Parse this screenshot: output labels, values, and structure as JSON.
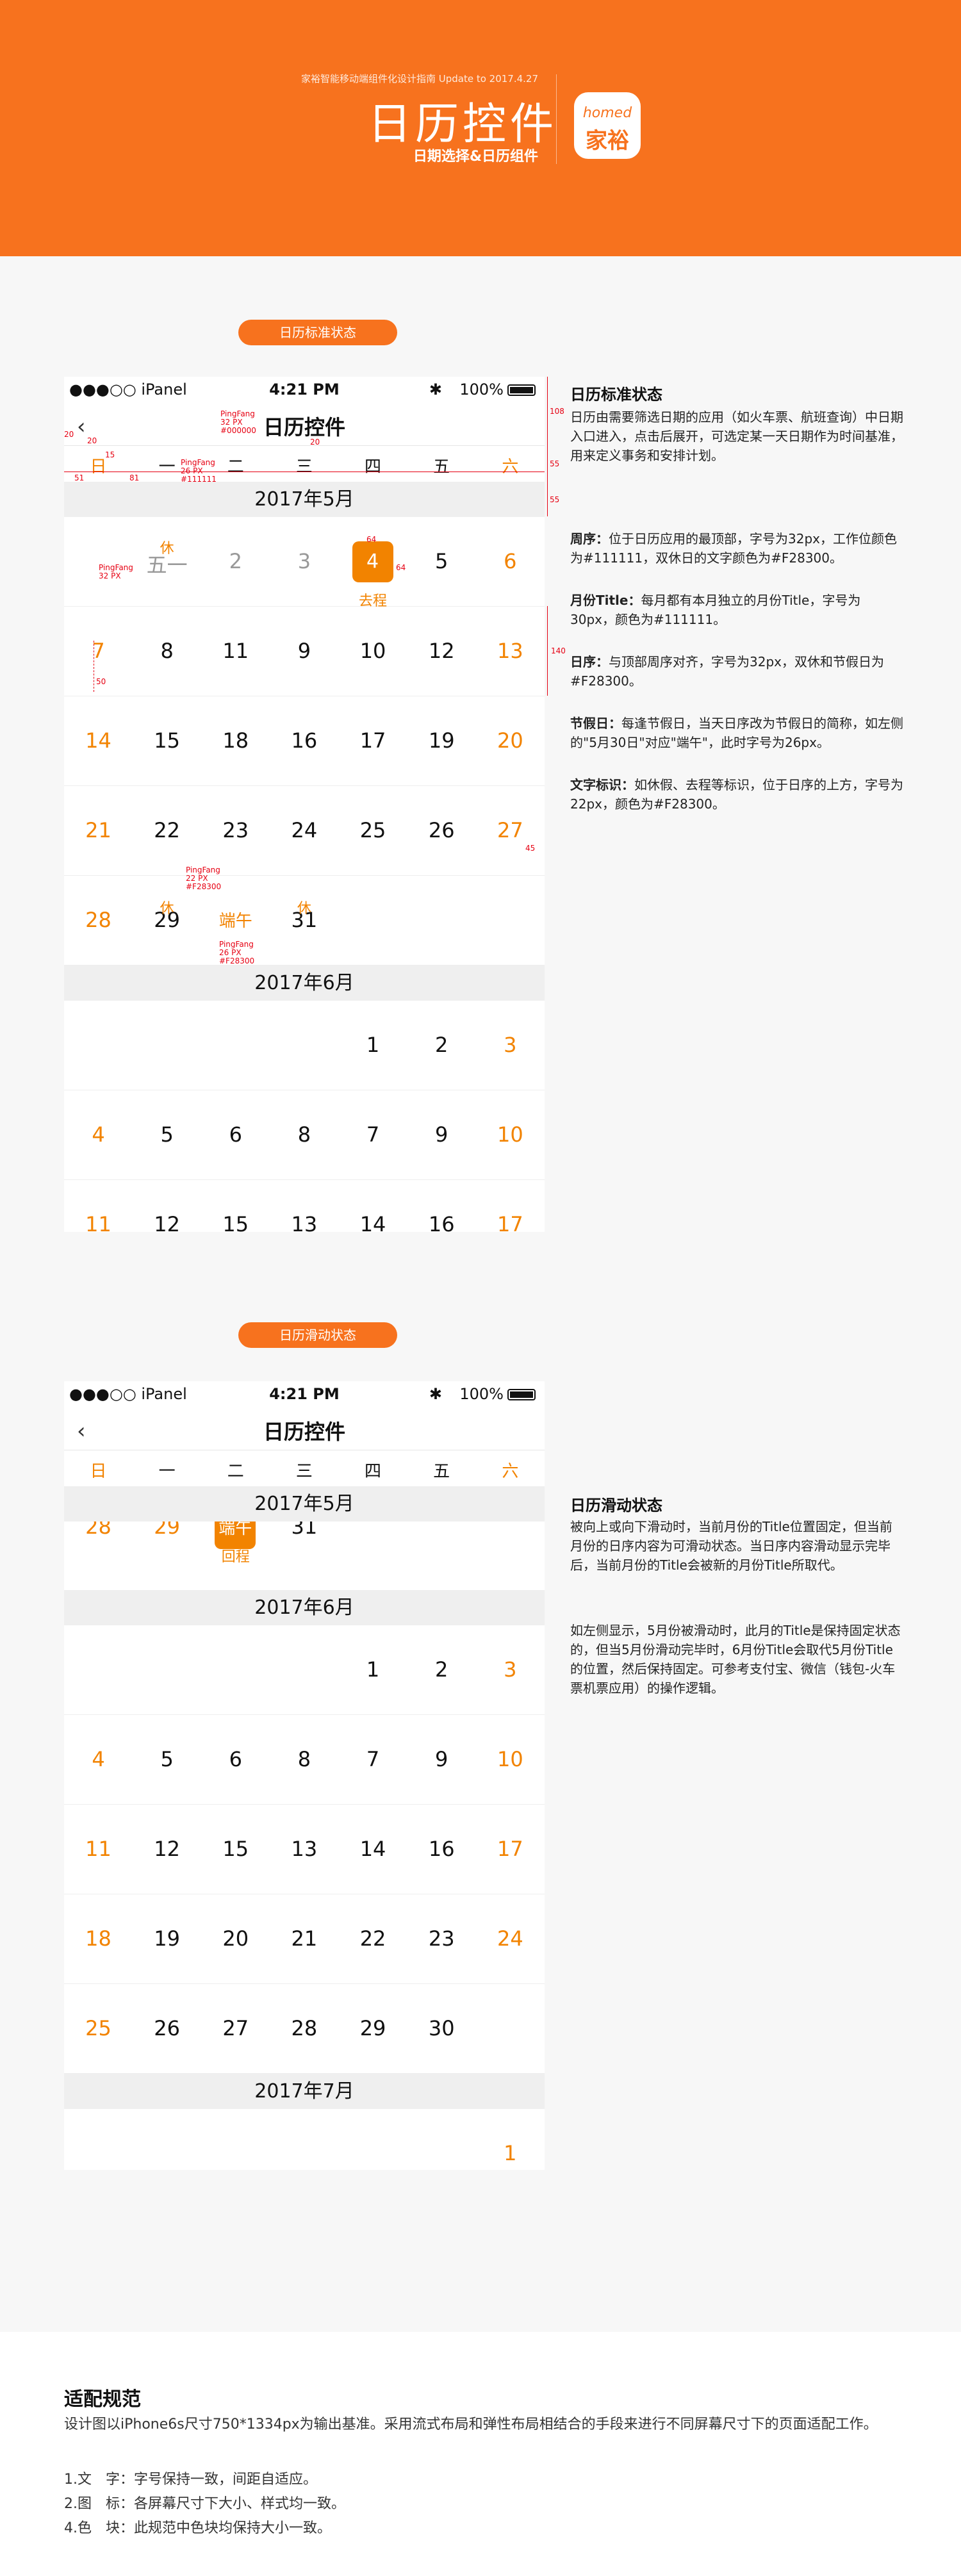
{
  "header": {
    "subtitle": "家裕智能移动端组件化设计指南  Update to 2017.4.27",
    "title": "日历控件",
    "desc": "日期选择&日历组件",
    "logo_top": "homed",
    "logo_bottom": "家裕"
  },
  "section1": {
    "pill": "日历标准状态",
    "phone": {
      "carrier": "●●●○○ iPanel",
      "time": "4:21 PM",
      "battery": "100%",
      "back": "‹",
      "title": "日历控件",
      "week": [
        "日",
        "一",
        "二",
        "三",
        "四",
        "五",
        "六"
      ],
      "may_title": "2017年5月",
      "may_rows": [
        [
          "",
          "五一",
          "2",
          "3",
          "4",
          "5",
          "6"
        ],
        [
          "7",
          "8",
          "11",
          "9",
          "10",
          "12",
          "13"
        ],
        [
          "14",
          "15",
          "18",
          "16",
          "17",
          "19",
          "20"
        ],
        [
          "21",
          "22",
          "23",
          "24",
          "25",
          "26",
          "27"
        ],
        [
          "28",
          "29",
          "端午",
          "31",
          "",
          "",
          ""
        ]
      ],
      "holiday_xiu_1": "休",
      "holiday_xiu_2": "休",
      "holiday_xiu_3": "休",
      "go_label": "去程",
      "june_title": "2017年6月",
      "june_rows": [
        [
          "",
          "",
          "",
          "",
          "1",
          "2",
          "3"
        ],
        [
          "4",
          "5",
          "6",
          "8",
          "7",
          "9",
          "10"
        ],
        [
          "11",
          "12",
          "15",
          "13",
          "14",
          "16",
          "17"
        ]
      ]
    },
    "annotations": {
      "a_title": "PingFang\n32 PX\n#000000",
      "a_week": "PingFang\n26 PX\n#111111",
      "a_day": "PingFang\n32 PX",
      "a_note": "PingFang\n22 PX\n#F28300",
      "a_holiday": "PingFang\n26 PX\n#F28300",
      "n108": "108",
      "n55a": "55",
      "n55b": "55",
      "n140": "140",
      "n64a": "64",
      "n64b": "64",
      "n50": "50",
      "n45": "45",
      "n20a": "20",
      "n20b": "20",
      "n20c": "20",
      "n15": "15",
      "n51": "51",
      "n81": "81"
    },
    "right": {
      "title": "日历标准状态",
      "intro": "日历由需要筛选日期的应用（如火车票、航班查询）中日期入口进入，点击后展开，可选定某一天日期作为时间基准，用来定义事务和安排计划。",
      "p1_bold": "周序：",
      "p1": "位于日历应用的最顶部，字号为32px，工作位颜色为#111111，双休日的文字颜色为#F28300。",
      "p2_bold": "月份Title：",
      "p2": "每月都有本月独立的月份Title，字号为30px，颜色为#111111。",
      "p3_bold": "日序：",
      "p3": "与顶部周序对齐，字号为32px，双休和节假日为#F28300。",
      "p4_bold": "节假日：",
      "p4": "每逢节假日，当天日序改为节假日的简称，如左侧的\"5月30日\"对应\"端午\"，此时字号为26px。",
      "p5_bold": "文字标识：",
      "p5": "如休假、去程等标识，位于日序的上方，字号为22px，颜色为#F28300。"
    }
  },
  "section2": {
    "pill": "日历滑动状态",
    "phone": {
      "carrier": "●●●○○ iPanel",
      "time": "4:21 PM",
      "battery": "100%",
      "back": "‹",
      "title": "日历控件",
      "week": [
        "日",
        "一",
        "二",
        "三",
        "四",
        "五",
        "六"
      ],
      "may_title": "2017年5月",
      "may_partial": [
        "28",
        "29",
        "端午",
        "31"
      ],
      "return_label": "回程",
      "june_title": "2017年6月",
      "june_rows": [
        [
          "",
          "",
          "",
          "",
          "1",
          "2",
          "3"
        ],
        [
          "4",
          "5",
          "6",
          "8",
          "7",
          "9",
          "10"
        ],
        [
          "11",
          "12",
          "15",
          "13",
          "14",
          "16",
          "17"
        ],
        [
          "18",
          "19",
          "20",
          "21",
          "22",
          "23",
          "24"
        ],
        [
          "25",
          "26",
          "27",
          "28",
          "29",
          "30",
          ""
        ]
      ],
      "july_title": "2017年7月",
      "july_rows": [
        [
          "",
          "",
          "",
          "",
          "",
          "",
          "1"
        ]
      ]
    },
    "right": {
      "title": "日历滑动状态",
      "p1": "被向上或向下滑动时，当前月份的Title位置固定，但当前月份的日序内容为可滑动状态。当日序内容滑动显示完毕后，当前月份的Title会被新的月份Title所取代。",
      "p2": "如左侧显示，5月份被滑动时，此月的Title是保持固定状态的，但当5月份滑动完毕时，6月份Title会取代5月份Title的位置，然后保持固定。可参考支付宝、微信（钱包-火车票机票应用）的操作逻辑。"
    }
  },
  "footer": {
    "title": "适配规范",
    "desc": "设计图以iPhone6s尺寸750*1334px为输出基准。采用流式布局和弹性布局相结合的手段来进行不同屏幕尺寸下的页面适配工作。",
    "items": [
      "1.文　字：字号保持一致，间距自适应。",
      "2.图　标：各屏幕尺寸下大小、样式均一致。",
      "4.色　块：此规范中色块均保持大小一致。"
    ]
  },
  "colors": {
    "accent": "#f7721e",
    "holiday": "#F28300",
    "text": "#111111",
    "annotation": "#e60012"
  }
}
